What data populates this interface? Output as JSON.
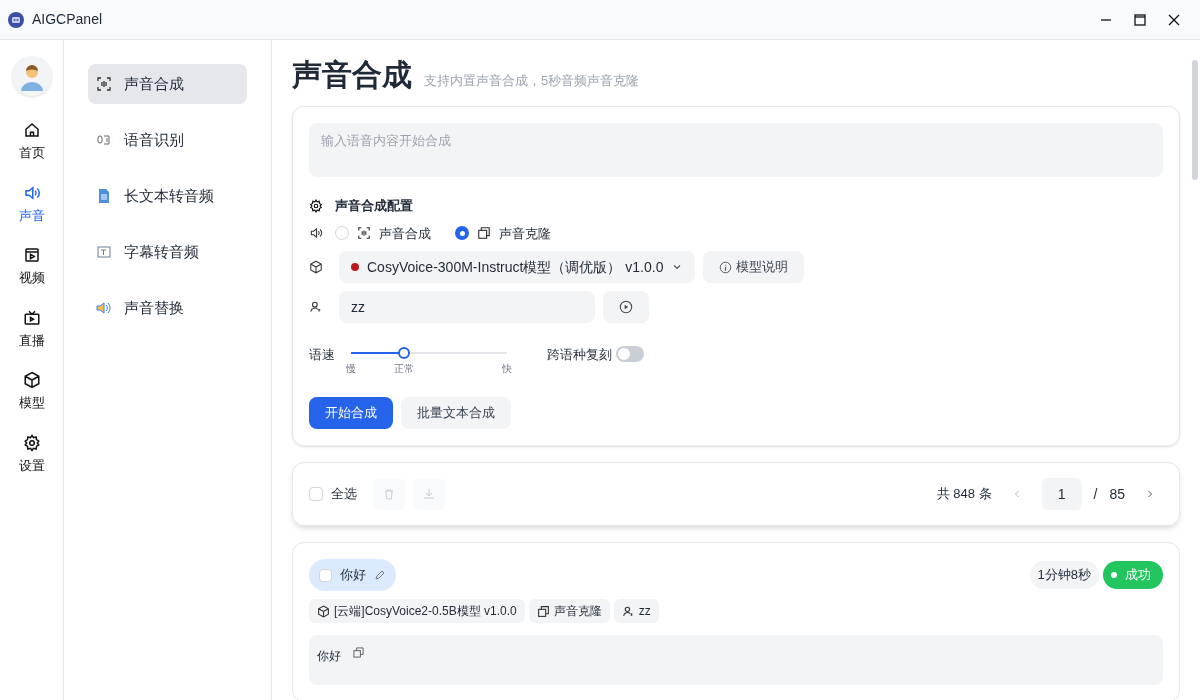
{
  "window": {
    "title": "AIGCPanel"
  },
  "rail": {
    "items": [
      {
        "kind": "home",
        "label": "首页",
        "selected": false
      },
      {
        "kind": "sound",
        "label": "声音",
        "selected": true
      },
      {
        "kind": "video",
        "label": "视频",
        "selected": false
      },
      {
        "kind": "live",
        "label": "直播",
        "selected": false
      },
      {
        "kind": "model",
        "label": "模型",
        "selected": false
      },
      {
        "kind": "settings",
        "label": "设置",
        "selected": false
      }
    ]
  },
  "subnav": {
    "items": [
      {
        "kind": "synth",
        "label": "声音合成",
        "selected": true
      },
      {
        "kind": "asr",
        "label": "语音识别",
        "selected": false
      },
      {
        "kind": "doc",
        "label": "长文本转音频",
        "selected": false
      },
      {
        "kind": "subtitle",
        "label": "字幕转音频",
        "selected": false
      },
      {
        "kind": "replace",
        "label": "声音替换",
        "selected": false
      }
    ]
  },
  "page": {
    "title": "声音合成",
    "subtitle": "支持内置声音合成，5秒音频声音克隆"
  },
  "synth": {
    "input_placeholder": "输入语音内容开始合成",
    "config_title": "声音合成配置",
    "modes": [
      {
        "kind": "synth",
        "label": "声音合成",
        "selected": false
      },
      {
        "kind": "clone",
        "label": "声音克隆",
        "selected": true
      }
    ],
    "model": {
      "name": "CosyVoice-300M-Instruct模型（调优版） v1.0.0",
      "color": "#b91c1c"
    },
    "model_help": "模型说明",
    "voice": "zz",
    "speed": {
      "label": "语速",
      "level": 0.34,
      "marks": [
        "慢",
        "正常",
        "快"
      ]
    },
    "cross_lingual": {
      "label": "跨语种复刻",
      "on": false
    },
    "buttons": [
      {
        "kind": "primary",
        "label": "开始合成"
      },
      {
        "kind": "secondary",
        "label": "批量文本合成"
      }
    ]
  },
  "toolbar": {
    "select_all": {
      "label": "全选",
      "checked": false
    },
    "total": "共 848 条",
    "page": "1",
    "separator": "/",
    "pages": "85"
  },
  "records": [
    {
      "title": "你好",
      "checked": false,
      "duration": "1分钟8秒",
      "status": "成功",
      "tags": [
        {
          "kind": "model",
          "label": "[云端]CosyVoice2-0.5B模型 v1.0.0"
        },
        {
          "kind": "clone",
          "label": "声音克隆"
        },
        {
          "kind": "voice",
          "label": "zz"
        }
      ],
      "text": "你好"
    }
  ]
}
